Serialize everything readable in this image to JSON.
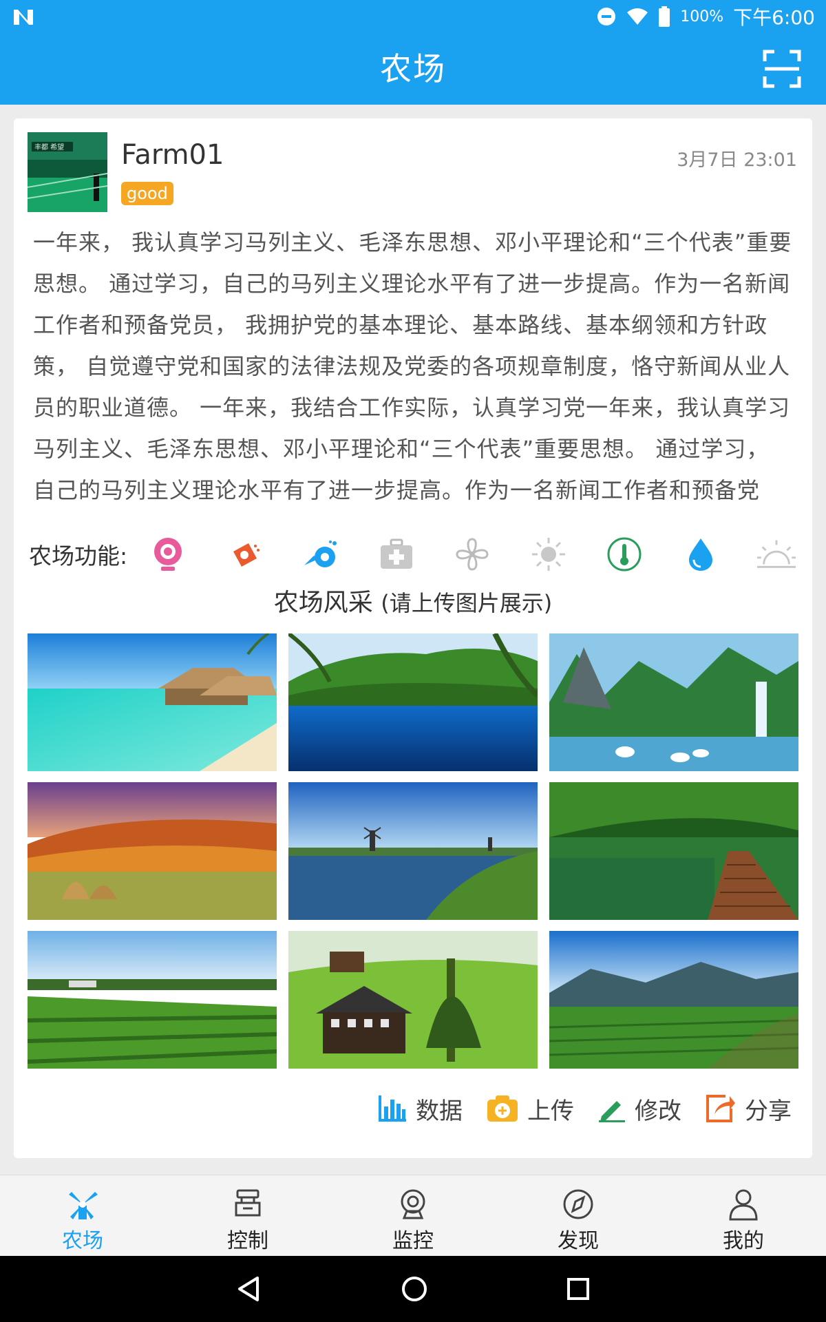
{
  "status_bar": {
    "battery": "100%",
    "time": "下午6:00"
  },
  "app_bar": {
    "title": "农场"
  },
  "farm": {
    "name": "Farm01",
    "badge": "good",
    "date": "3月7日 23:01",
    "description": "一年来， 我认真学习马列主义、毛泽东思想、邓小平理论和“三个代表”重要思想。 通过学习，自己的马列主义理论水平有了进一步提高。作为一名新闻工作者和预备党员， 我拥护党的基本理论、基本路线、基本纲领和方针政策， 自觉遵守党和国家的法律法规及党委的各项规章制度，恪守新闻从业人员的职业道德。 一年来，我结合工作实际，认真学习党一年来，我认真学习马列主义、毛泽东思想、邓小平理论和“三个代表”重要思想。 通过学习， 自己的马列主义理论水平有了进一步提高。作为一名新闻工作者和预备党员， 我拥护党的基本理论、基本路线、基本纲领和方针政策"
  },
  "functions": {
    "label": "农场功能:",
    "icons": [
      "camera-icon",
      "sprinkler-icon",
      "watering-can-icon",
      "medical-kit-icon",
      "fan-icon",
      "light-icon",
      "thermometer-icon",
      "water-drop-icon",
      "sunrise-icon"
    ]
  },
  "gallery": {
    "title": "农场风采",
    "subtitle": "(请上传图片展示)"
  },
  "actions": [
    {
      "label": "数据",
      "icon": "bar-chart-icon"
    },
    {
      "label": "上传",
      "icon": "upload-icon"
    },
    {
      "label": "修改",
      "icon": "edit-icon"
    },
    {
      "label": "分享",
      "icon": "share-icon"
    }
  ],
  "tabs": [
    {
      "label": "农场",
      "icon": "windmill-icon",
      "active": true
    },
    {
      "label": "控制",
      "icon": "control-icon",
      "active": false
    },
    {
      "label": "监控",
      "icon": "webcam-icon",
      "active": false
    },
    {
      "label": "发现",
      "icon": "compass-icon",
      "active": false
    },
    {
      "label": "我的",
      "icon": "person-icon",
      "active": false
    }
  ],
  "colors": {
    "primary": "#1aa1f0",
    "badge": "#f5a623"
  }
}
